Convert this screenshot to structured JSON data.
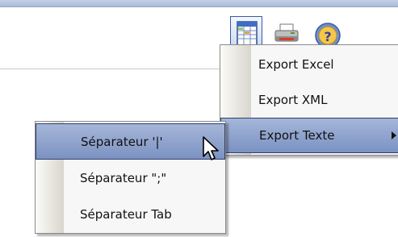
{
  "toolbar": {
    "buttons": [
      {
        "name": "export-excel-button",
        "icon": "spreadsheet-icon"
      },
      {
        "name": "print-button",
        "icon": "printer-icon"
      },
      {
        "name": "help-button",
        "icon": "help-icon"
      }
    ]
  },
  "export_menu": {
    "items": [
      {
        "label": "Export Excel"
      },
      {
        "label": "Export XML"
      },
      {
        "label": "Export Texte",
        "has_submenu": true,
        "selected": true
      }
    ]
  },
  "separator_submenu": {
    "items": [
      {
        "label": "Séparateur '|'",
        "selected": true
      },
      {
        "label": "Séparateur \";\""
      },
      {
        "label": "Séparateur Tab"
      }
    ]
  },
  "colors": {
    "highlight_top": "#a5b6d8",
    "highlight_bottom": "#7b92c2",
    "menu_background": "#f7f7f7",
    "top_bar": "#b4c6e0"
  },
  "cursor": {
    "icon": "arrow-cursor-icon"
  }
}
